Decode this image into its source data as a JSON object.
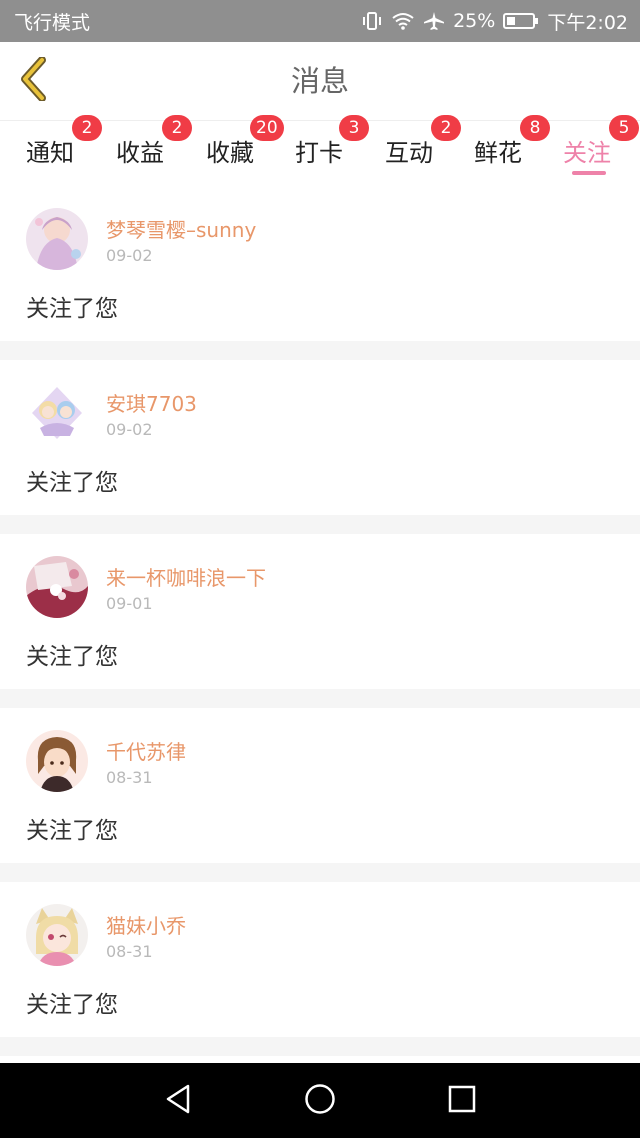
{
  "status_bar": {
    "left_text": "飞行模式",
    "battery": "25%",
    "time": "下午2:02",
    "icons": [
      "vibrate-icon",
      "wifi-icon",
      "airplane-icon",
      "battery-icon"
    ]
  },
  "header": {
    "title": "消息",
    "back_icon": "chevron-left-icon"
  },
  "tabs": [
    {
      "label": "通知",
      "badge": "2"
    },
    {
      "label": "收益",
      "badge": "2"
    },
    {
      "label": "收藏",
      "badge": "20"
    },
    {
      "label": "打卡",
      "badge": "3"
    },
    {
      "label": "互动",
      "badge": "2"
    },
    {
      "label": "鲜花",
      "badge": "8"
    },
    {
      "label": "关注",
      "badge": "5"
    }
  ],
  "active_tab": "关注",
  "messages": [
    {
      "user": "梦琴雪樱–sunny",
      "date": "09-02",
      "text": "关注了您"
    },
    {
      "user": "安琪7703",
      "date": "09-02",
      "text": "关注了您"
    },
    {
      "user": "来一杯咖啡浪一下",
      "date": "09-01",
      "text": "关注了您"
    },
    {
      "user": "千代苏律",
      "date": "08-31",
      "text": "关注了您"
    },
    {
      "user": "猫妹小乔",
      "date": "08-31",
      "text": "关注了您"
    }
  ],
  "nav_bar": {
    "icons": [
      "back-triangle-icon",
      "home-circle-icon",
      "recents-square-icon"
    ]
  },
  "colors": {
    "accent": "#ee82a9",
    "badge": "#f03c46",
    "username": "#e8976a",
    "back_icon": "#e8c23a"
  }
}
